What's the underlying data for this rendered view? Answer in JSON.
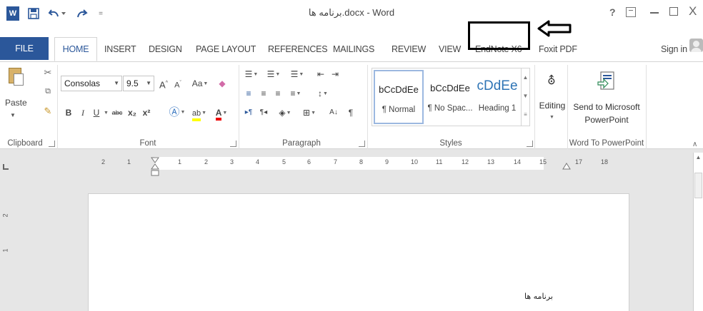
{
  "window": {
    "title": "برنامه ها.docx - Word",
    "help": "?",
    "close": "X"
  },
  "tabs": [
    {
      "label": "FILE"
    },
    {
      "label": "HOME"
    },
    {
      "label": "INSERT"
    },
    {
      "label": "DESIGN"
    },
    {
      "label": "PAGE LAYOUT"
    },
    {
      "label": "REFERENCES"
    },
    {
      "label": "MAILINGS"
    },
    {
      "label": "REVIEW"
    },
    {
      "label": "VIEW"
    },
    {
      "label": "EndNote X6"
    },
    {
      "label": "Foxit PDF"
    }
  ],
  "signin": "Sign in",
  "clipboard": {
    "paste_label": "Paste",
    "group_label": "Clipboard"
  },
  "font": {
    "name": "Consolas",
    "size": "9.5",
    "change_case": "Aa",
    "bold": "B",
    "italic": "I",
    "underline": "U",
    "strikethrough": "abc",
    "subscript": "x₂",
    "superscript": "x²",
    "group_label": "Font"
  },
  "paragraph": {
    "group_label": "Paragraph"
  },
  "styles": {
    "items": [
      {
        "sample": "bCcDdEe",
        "name": "¶ Normal"
      },
      {
        "sample": "bCcDdEe",
        "name": "¶ No Spac..."
      },
      {
        "sample": "cDdEe",
        "name": "Heading 1"
      }
    ],
    "group_label": "Styles"
  },
  "editing": {
    "label": "Editing"
  },
  "word_to_ppt": {
    "send_line1": "Send to Microsoft",
    "send_line2": "PowerPoint",
    "group_label": "Word To PowerPoint"
  },
  "ruler": {
    "numbers": [
      "2",
      "1",
      "1",
      "2",
      "3",
      "4",
      "5",
      "6",
      "7",
      "8",
      "9",
      "10",
      "11",
      "12",
      "13",
      "14",
      "15",
      "17",
      "18"
    ],
    "vertical": [
      "2",
      "1"
    ]
  },
  "document": {
    "text": "برنامه ها"
  },
  "colors": {
    "word_blue": "#2b579a",
    "heading_blue": "#2e74b5"
  }
}
